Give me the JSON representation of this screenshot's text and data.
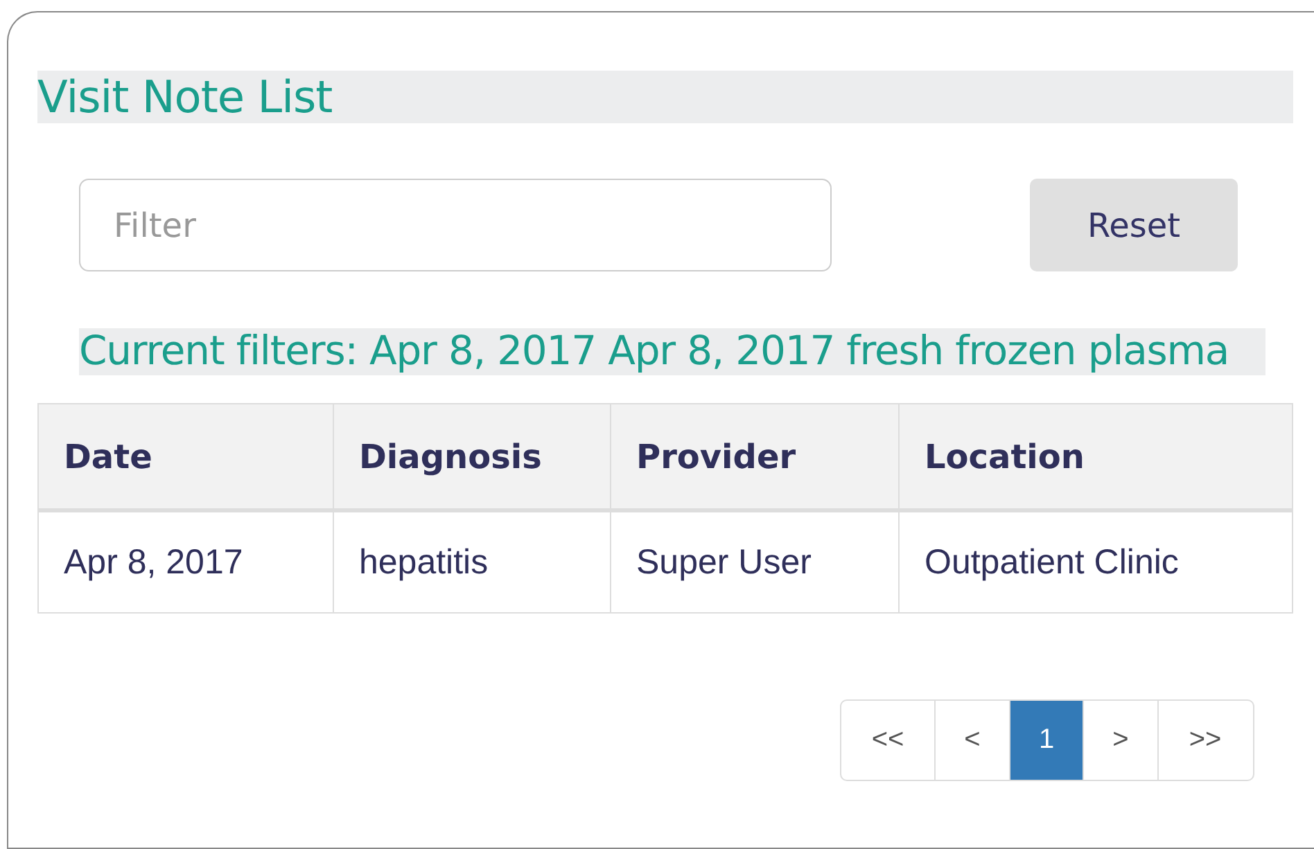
{
  "title": "Visit Note List",
  "filter": {
    "placeholder": "Filter"
  },
  "reset_button": "Reset",
  "current_filters": "Current filters: Apr 8, 2017 Apr 8, 2017 fresh frozen plasma",
  "table": {
    "columns": [
      "Date",
      "Diagnosis",
      "Provider",
      "Location"
    ],
    "rows": [
      [
        "Apr 8, 2017",
        "hepatitis",
        "Super User",
        "Outpatient Clinic"
      ]
    ]
  },
  "pagination": [
    {
      "label": "<<",
      "selected": false
    },
    {
      "label": "<",
      "selected": false
    },
    {
      "label": "1",
      "selected": true
    },
    {
      "label": ">",
      "selected": false
    },
    {
      "label": ">>",
      "selected": false
    }
  ]
}
